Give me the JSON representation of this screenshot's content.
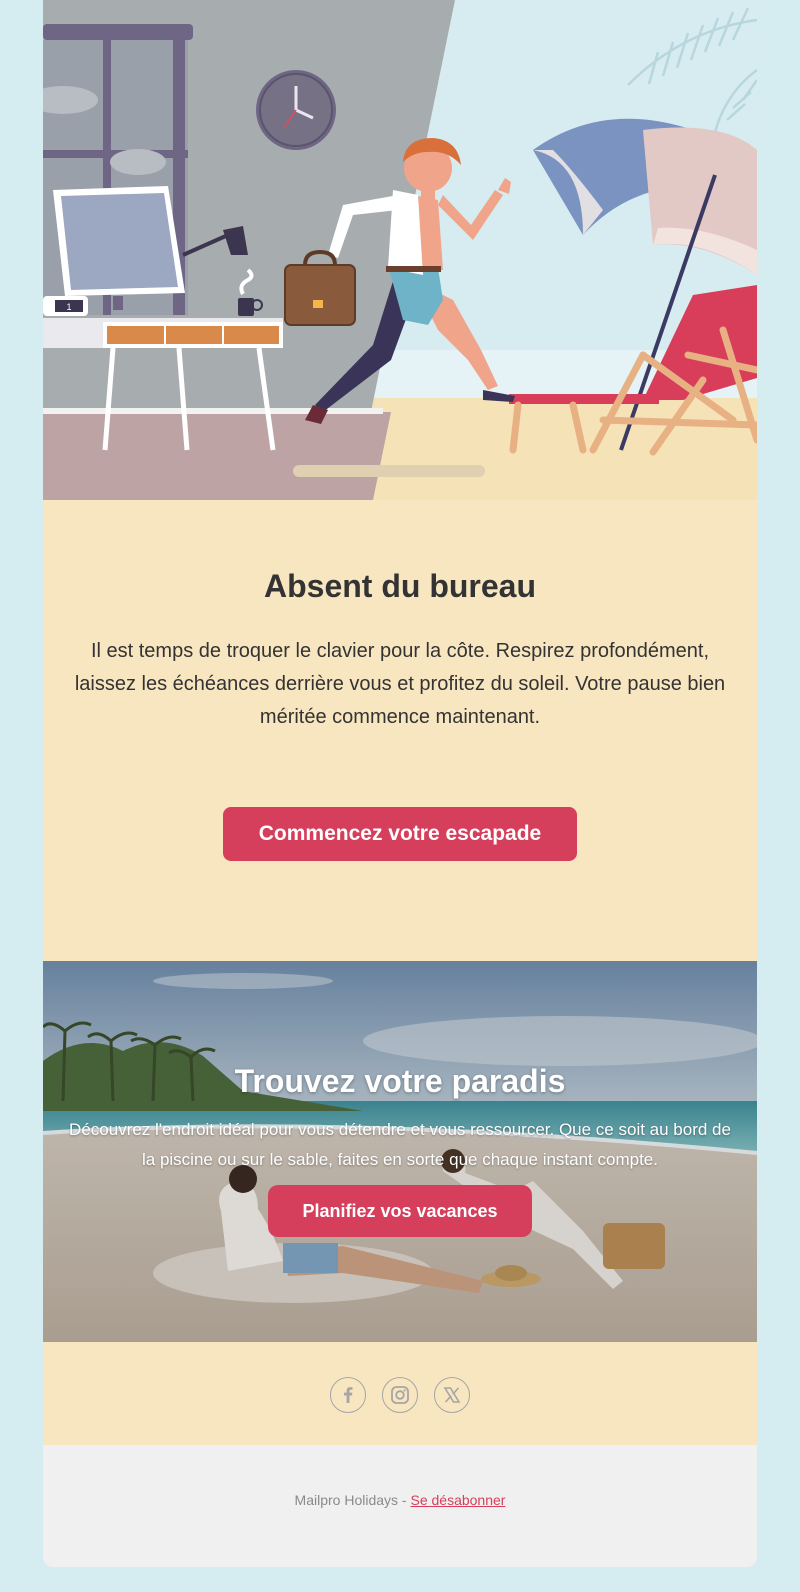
{
  "hero": {
    "illustration": "office-to-beach-illustration",
    "desk_clock_text": "1",
    "icons": [
      "wall-clock-icon",
      "briefcase-icon",
      "beach-umbrella-icon",
      "deck-chair-icon"
    ]
  },
  "intro": {
    "title": "Absent du bureau",
    "body": "Il est temps de troquer le clavier pour la côte. Respirez profondément, laissez les échéances derrière vous et profitez du soleil. Votre pause bien méritée commence maintenant.",
    "cta_label": "Commencez votre escapade"
  },
  "promo": {
    "title": "Trouvez votre paradis",
    "body": "Découvrez l'endroit idéal pour vous détendre et vous ressourcer. Que ce soit au bord de la piscine ou sur le sable, faites en sorte que chaque instant compte.",
    "cta_label": "Planifiez vos vacances",
    "image": "couple-relaxing-on-beach-photo"
  },
  "social": {
    "icons": [
      "facebook-icon",
      "instagram-icon",
      "x-icon"
    ]
  },
  "footer": {
    "sender": "Mailpro Holidays",
    "separator": " - ",
    "unsubscribe_label": "Se désabonner"
  },
  "colors": {
    "page_background": "#d5ecf1",
    "sand": "#f8e6c0",
    "accent": "#d63f5c",
    "text": "#333333",
    "footer_background": "#f0f0f0"
  }
}
